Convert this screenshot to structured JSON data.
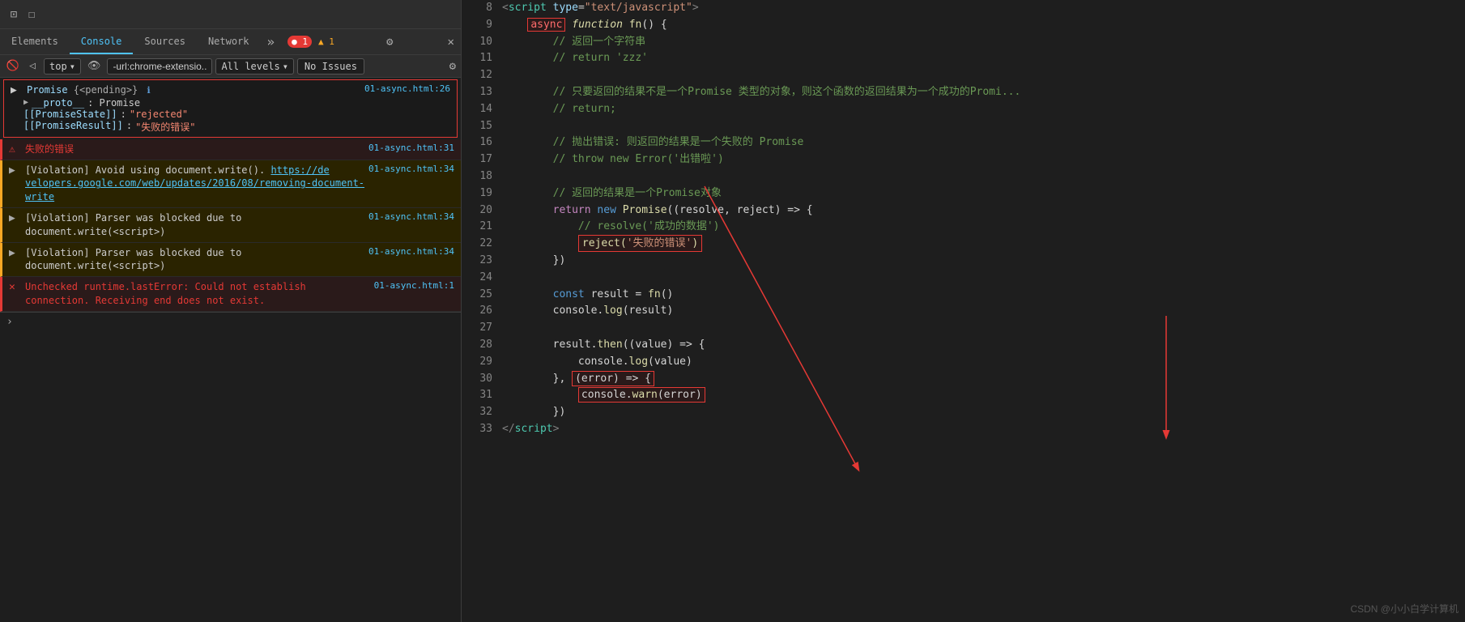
{
  "devtools": {
    "toolbar": {
      "inspect_label": "⊡",
      "device_label": "☐"
    },
    "tabs": [
      {
        "label": "Elements",
        "active": false
      },
      {
        "label": "Console",
        "active": true
      },
      {
        "label": "Sources",
        "active": false
      },
      {
        "label": "Network",
        "active": false
      }
    ],
    "tabs_more": "»",
    "badge_error": "●1",
    "badge_warn": "▲1",
    "gear_icon": "⚙",
    "close_icon": "✕",
    "console_toolbar": {
      "clear_icon": "🚫",
      "top_label": "top",
      "chevron": "▾",
      "eye_icon": "👁",
      "url_filter": "-url:chrome-extensio...",
      "all_levels": "All levels",
      "no_issues": "No Issues",
      "settings": "⚙"
    },
    "console_entries": [
      {
        "type": "object",
        "source": "01-async.html:26",
        "icon": "▶",
        "content": "Promise {<pending>}",
        "info_icon": "ℹ",
        "details": [
          {
            "key": "__proto__",
            "val": "Promise",
            "type": "proto"
          },
          {
            "key": "[[PromiseState]]",
            "val": "\"rejected\"",
            "type": "kv-string"
          },
          {
            "key": "[[PromiseResult]]",
            "val": "\"失败的错误\"",
            "type": "kv-string"
          }
        ]
      },
      {
        "type": "error",
        "source": "01-async.html:31",
        "icon": "⚠",
        "content": "失败的错误"
      },
      {
        "type": "warn",
        "source": "01-async.html:34",
        "icon": "▶",
        "content": "[Violation] Avoid using document.write(). https://de velopers.google.com/web/updates/2016/08/removing-document-write"
      },
      {
        "type": "warn",
        "source": "01-async.html:34",
        "icon": "▶",
        "content": "[Violation] Parser was blocked due to document.write(<script>)"
      },
      {
        "type": "warn",
        "source": "01-async.html:34",
        "icon": "▶",
        "content": "[Violation] Parser was blocked due to document.write(<script>)"
      },
      {
        "type": "error",
        "source": "01-async.html:1",
        "icon": "✕",
        "content": "Unchecked runtime.lastError: Could not establish connection. Receiving end does not exist."
      }
    ]
  },
  "code": {
    "lines": [
      {
        "num": "8",
        "breakpoint": false,
        "tokens": [
          {
            "t": "tag_angle",
            "v": "<"
          },
          {
            "t": "tag_name",
            "v": "script"
          },
          {
            "t": "attr_name",
            "v": " type"
          },
          {
            "t": "plain",
            "v": "="
          },
          {
            "t": "attr_val",
            "v": "\"text/javascript\""
          },
          {
            "t": "tag_angle",
            "v": ">"
          }
        ]
      },
      {
        "num": "9",
        "breakpoint": false,
        "tokens": [
          {
            "t": "kw_async_box",
            "v": "async"
          },
          {
            "t": "plain",
            "v": " "
          },
          {
            "t": "kw_function",
            "v": "function"
          },
          {
            "t": "plain",
            "v": " "
          },
          {
            "t": "fn_name",
            "v": "fn"
          },
          {
            "t": "plain",
            "v": "() {"
          }
        ]
      },
      {
        "num": "10",
        "breakpoint": false,
        "tokens": [
          {
            "t": "comment",
            "v": "    // 返回一个字符串"
          }
        ]
      },
      {
        "num": "11",
        "breakpoint": false,
        "tokens": [
          {
            "t": "comment",
            "v": "    // return 'zzz'"
          }
        ]
      },
      {
        "num": "12",
        "breakpoint": false,
        "tokens": []
      },
      {
        "num": "13",
        "breakpoint": false,
        "tokens": [
          {
            "t": "comment",
            "v": "    // 只要返回的结果不是一个Promise 类型的对象，则这个函数的返回结果为一个成功的Promi..."
          }
        ]
      },
      {
        "num": "14",
        "breakpoint": false,
        "tokens": [
          {
            "t": "comment",
            "v": "    // return;"
          }
        ]
      },
      {
        "num": "15",
        "breakpoint": false,
        "tokens": []
      },
      {
        "num": "16",
        "breakpoint": false,
        "tokens": [
          {
            "t": "comment",
            "v": "    // 抛出错误: 则返回的结果是一个失败的 Promise"
          }
        ]
      },
      {
        "num": "17",
        "breakpoint": false,
        "tokens": [
          {
            "t": "comment",
            "v": "    // throw new Error('出错啦')"
          }
        ]
      },
      {
        "num": "18",
        "breakpoint": false,
        "tokens": []
      },
      {
        "num": "19",
        "breakpoint": false,
        "tokens": [
          {
            "t": "comment",
            "v": "    // 返回的结果是一个Promise对象"
          }
        ]
      },
      {
        "num": "20",
        "breakpoint": false,
        "tokens": [
          {
            "t": "kw_return",
            "v": "    return"
          },
          {
            "t": "plain",
            "v": " "
          },
          {
            "t": "kw_new",
            "v": "new"
          },
          {
            "t": "plain",
            "v": " "
          },
          {
            "t": "fn_name",
            "v": "Promise"
          },
          {
            "t": "plain",
            "v": "((resolve, reject) => {"
          }
        ]
      },
      {
        "num": "21",
        "breakpoint": false,
        "tokens": [
          {
            "t": "comment",
            "v": "        // resolve('成功的数据')"
          }
        ]
      },
      {
        "num": "22",
        "breakpoint": false,
        "tokens": [
          {
            "t": "highlighted",
            "v": "        reject('失败的错误')"
          }
        ]
      },
      {
        "num": "23",
        "breakpoint": false,
        "tokens": [
          {
            "t": "plain",
            "v": "    })"
          }
        ]
      },
      {
        "num": "24",
        "breakpoint": false,
        "tokens": []
      },
      {
        "num": "25",
        "breakpoint": false,
        "tokens": [
          {
            "t": "kw_const",
            "v": "    const"
          },
          {
            "t": "plain",
            "v": " result = "
          },
          {
            "t": "fn_name",
            "v": "fn"
          },
          {
            "t": "plain",
            "v": "()"
          }
        ]
      },
      {
        "num": "26",
        "breakpoint": false,
        "tokens": [
          {
            "t": "plain",
            "v": "    console."
          },
          {
            "t": "fn_name",
            "v": "log"
          },
          {
            "t": "plain",
            "v": "(result)"
          }
        ]
      },
      {
        "num": "27",
        "breakpoint": false,
        "tokens": []
      },
      {
        "num": "28",
        "breakpoint": false,
        "tokens": [
          {
            "t": "plain",
            "v": "    result."
          },
          {
            "t": "fn_name",
            "v": "then"
          },
          {
            "t": "plain",
            "v": "((value) => {"
          }
        ]
      },
      {
        "num": "29",
        "breakpoint": false,
        "tokens": [
          {
            "t": "plain",
            "v": "        console."
          },
          {
            "t": "fn_name",
            "v": "log"
          },
          {
            "t": "plain",
            "v": "(value)"
          }
        ]
      },
      {
        "num": "30",
        "breakpoint": false,
        "tokens": [
          {
            "t": "plain",
            "v": "    }, "
          },
          {
            "t": "highlighted2",
            "v": "(error) => {"
          }
        ]
      },
      {
        "num": "31",
        "breakpoint": false,
        "tokens": [
          {
            "t": "highlighted3",
            "v": "        console.warn(error)"
          }
        ]
      },
      {
        "num": "32",
        "breakpoint": false,
        "tokens": [
          {
            "t": "plain",
            "v": "    })"
          }
        ]
      },
      {
        "num": "33",
        "breakpoint": false,
        "tokens": [
          {
            "t": "tag_angle",
            "v": "</"
          },
          {
            "t": "tag_name",
            "v": "script"
          },
          {
            "t": "tag_angle",
            "v": ">"
          }
        ]
      }
    ],
    "watermark": "CSDN @小小白学计算机"
  }
}
